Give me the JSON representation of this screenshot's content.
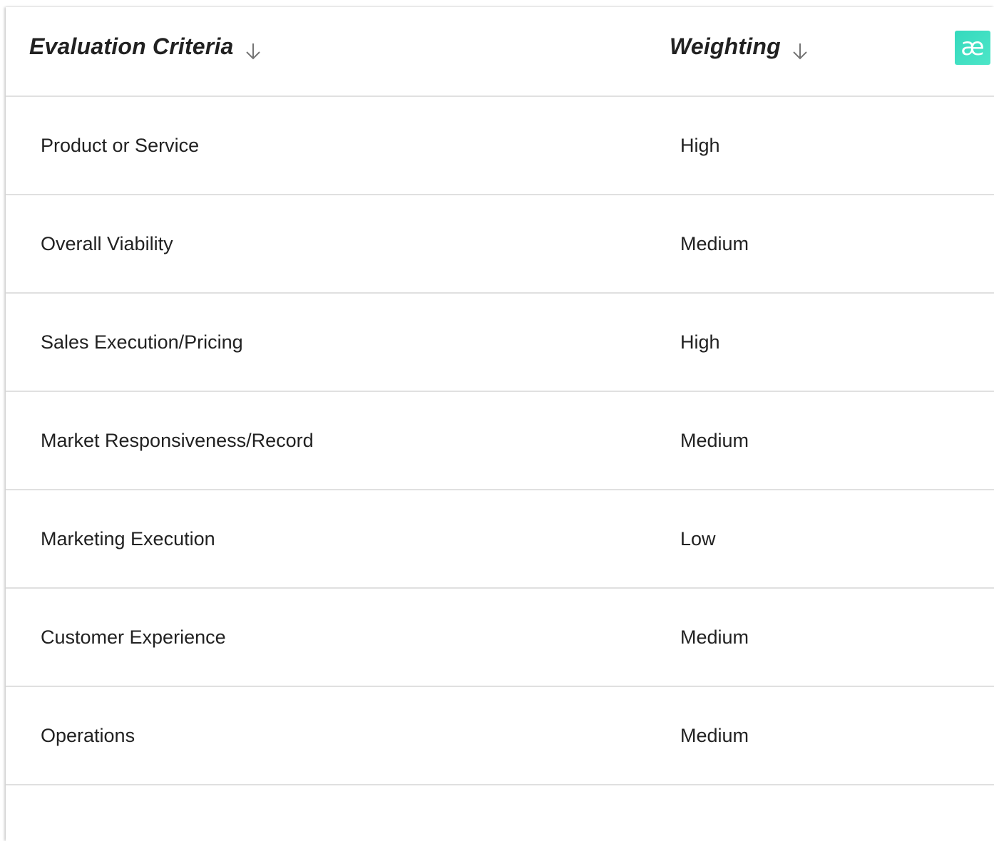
{
  "table": {
    "columns": [
      {
        "label": "Evaluation Criteria",
        "sort_icon": "arrow-down-icon"
      },
      {
        "label": "Weighting",
        "sort_icon": "arrow-down-icon"
      }
    ],
    "logo_text": "æ",
    "rows": [
      {
        "criteria": "Product or Service",
        "weighting": "High"
      },
      {
        "criteria": "Overall Viability",
        "weighting": "Medium"
      },
      {
        "criteria": "Sales Execution/Pricing",
        "weighting": "High"
      },
      {
        "criteria": "Market Responsiveness/Record",
        "weighting": "Medium"
      },
      {
        "criteria": "Marketing Execution",
        "weighting": "Low"
      },
      {
        "criteria": "Customer Experience",
        "weighting": "Medium"
      },
      {
        "criteria": "Operations",
        "weighting": "Medium"
      }
    ]
  },
  "colors": {
    "text": "#212121",
    "divider": "#e0e0e0",
    "sort_icon": "#757575",
    "logo": "#3ddcc1"
  }
}
